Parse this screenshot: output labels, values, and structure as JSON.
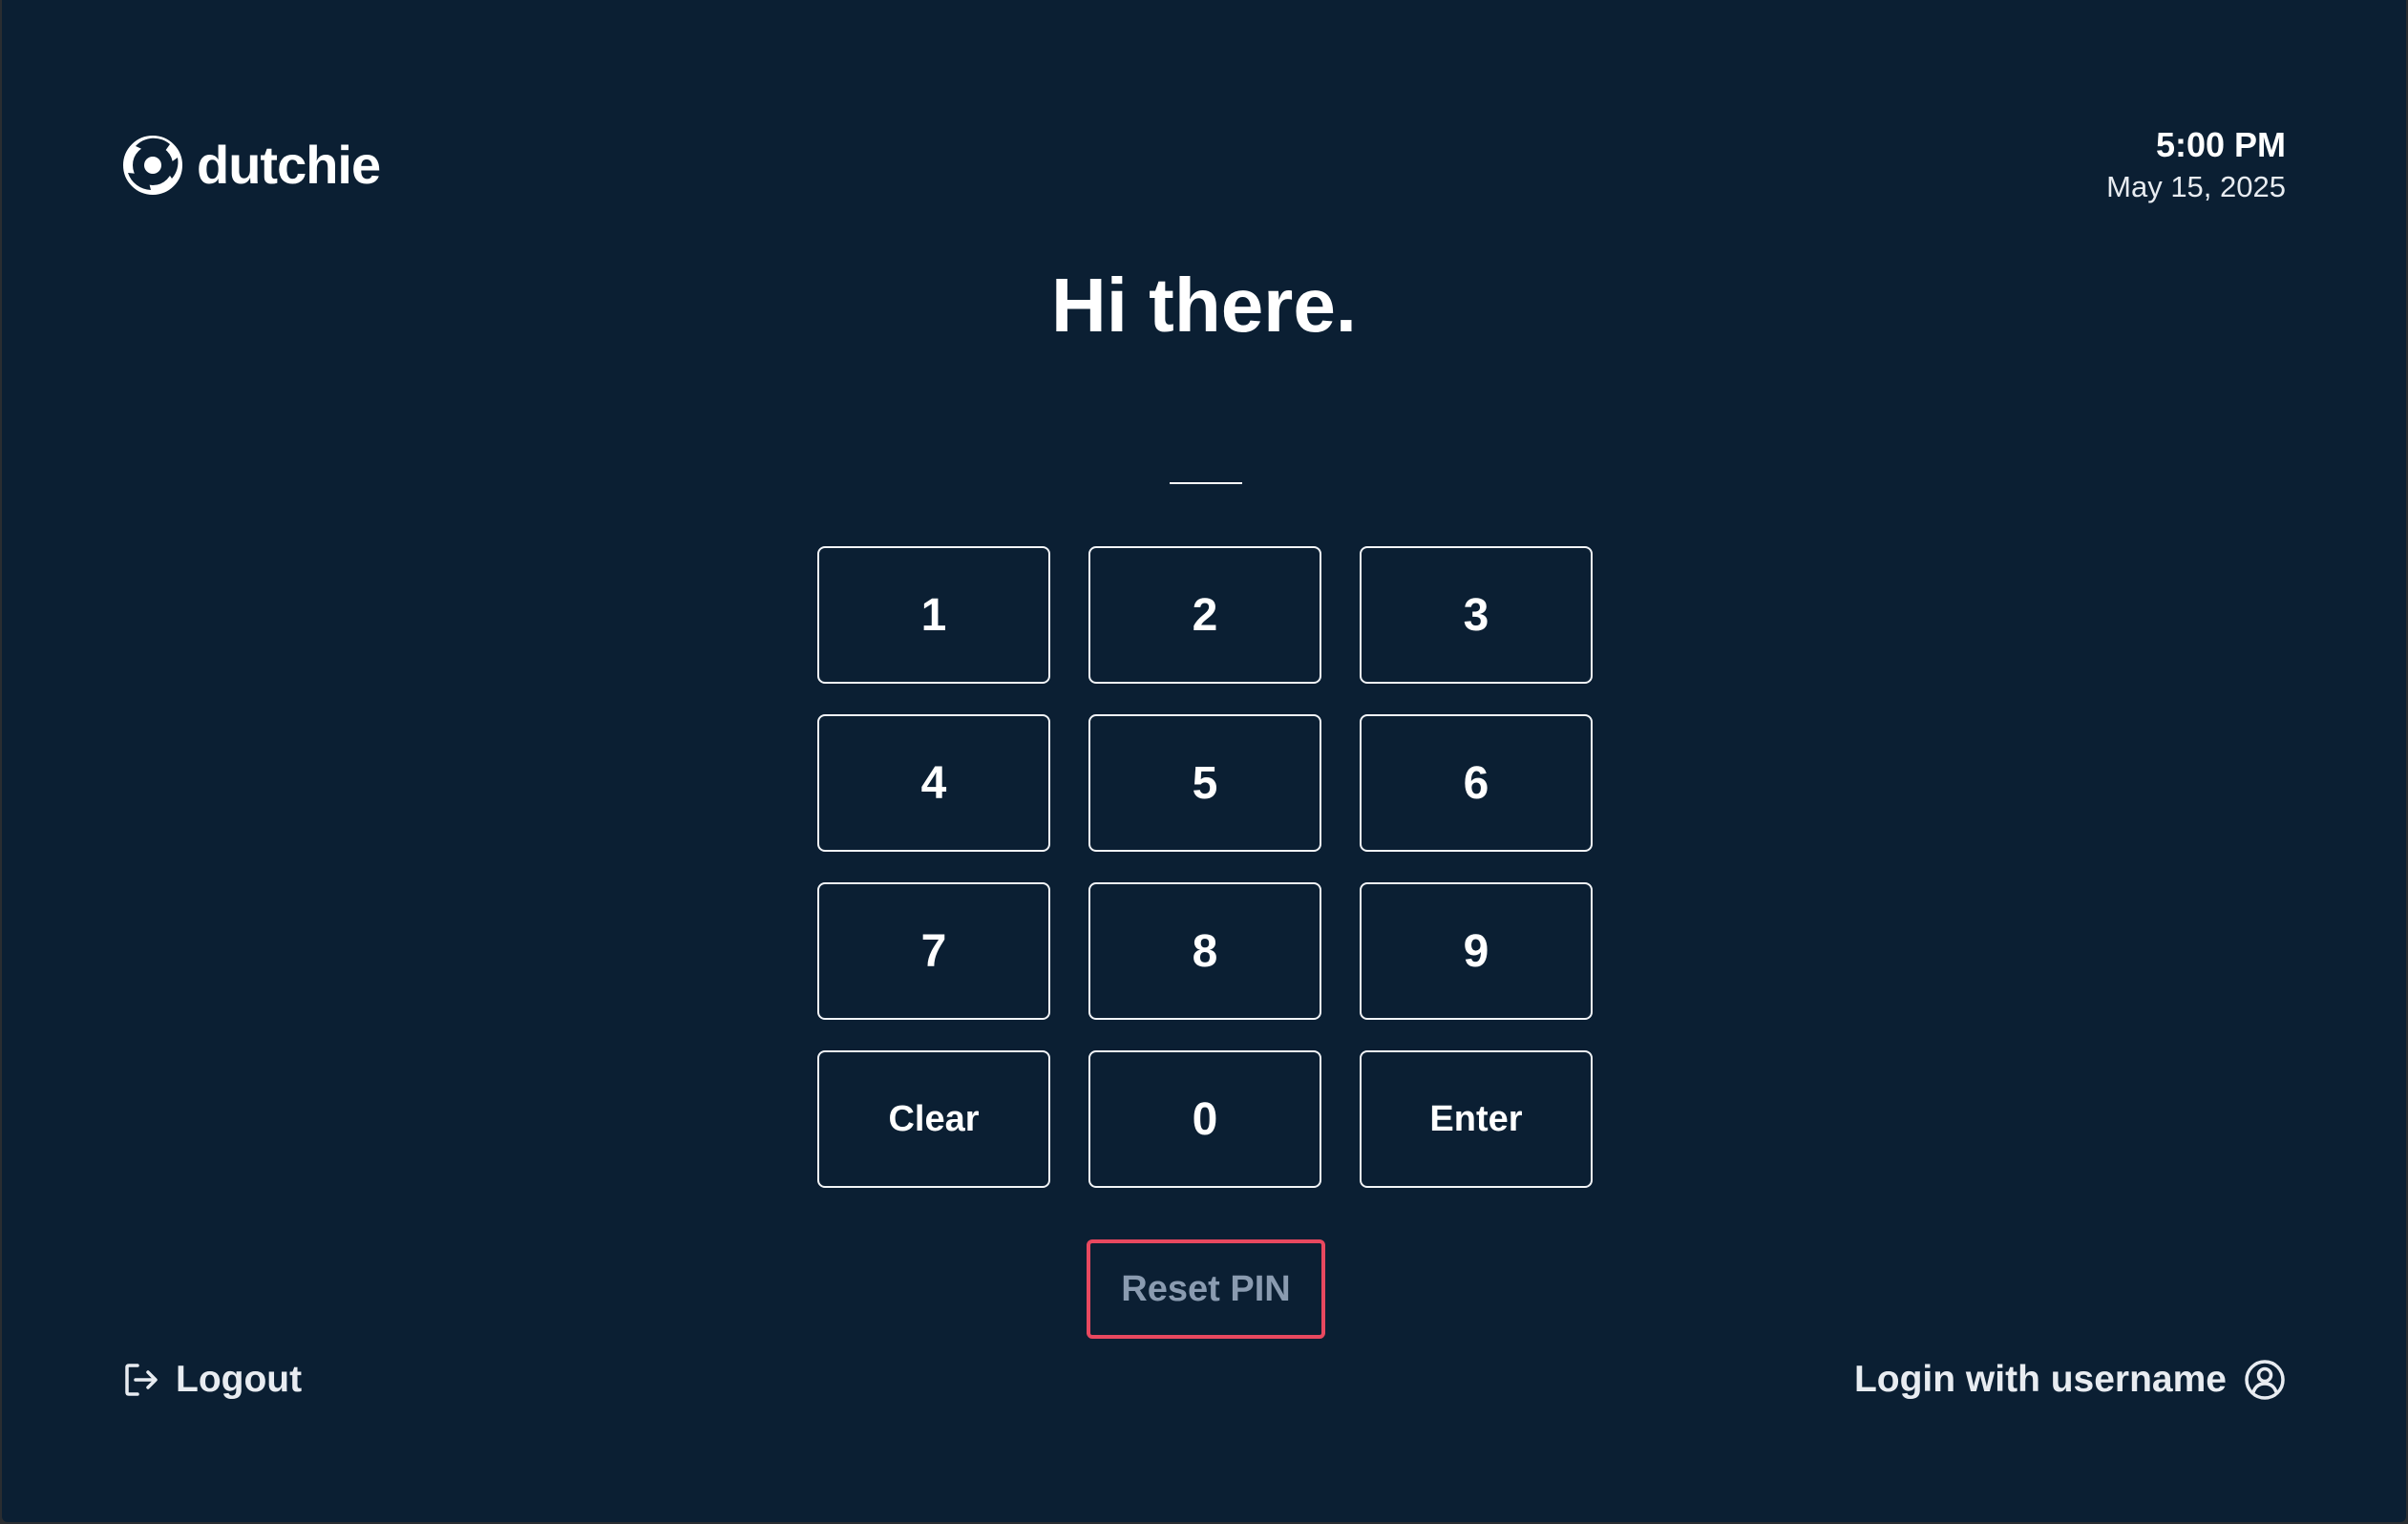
{
  "brand": {
    "name": "dutchie"
  },
  "clock": {
    "time": "5:00 PM",
    "date": "May 15, 2025"
  },
  "greeting": "Hi there.",
  "keypad": {
    "keys": [
      "1",
      "2",
      "3",
      "4",
      "5",
      "6",
      "7",
      "8",
      "9",
      "Clear",
      "0",
      "Enter"
    ]
  },
  "actions": {
    "reset_pin": "Reset PIN",
    "logout": "Logout",
    "login_with_username": "Login with username"
  },
  "colors": {
    "background": "#0b1f33",
    "highlight": "#e8485f",
    "muted_text": "#8a9bb0"
  },
  "icons": {
    "logo": "dutchie-logo-icon",
    "logout": "logout-icon",
    "user": "user-circle-icon"
  }
}
